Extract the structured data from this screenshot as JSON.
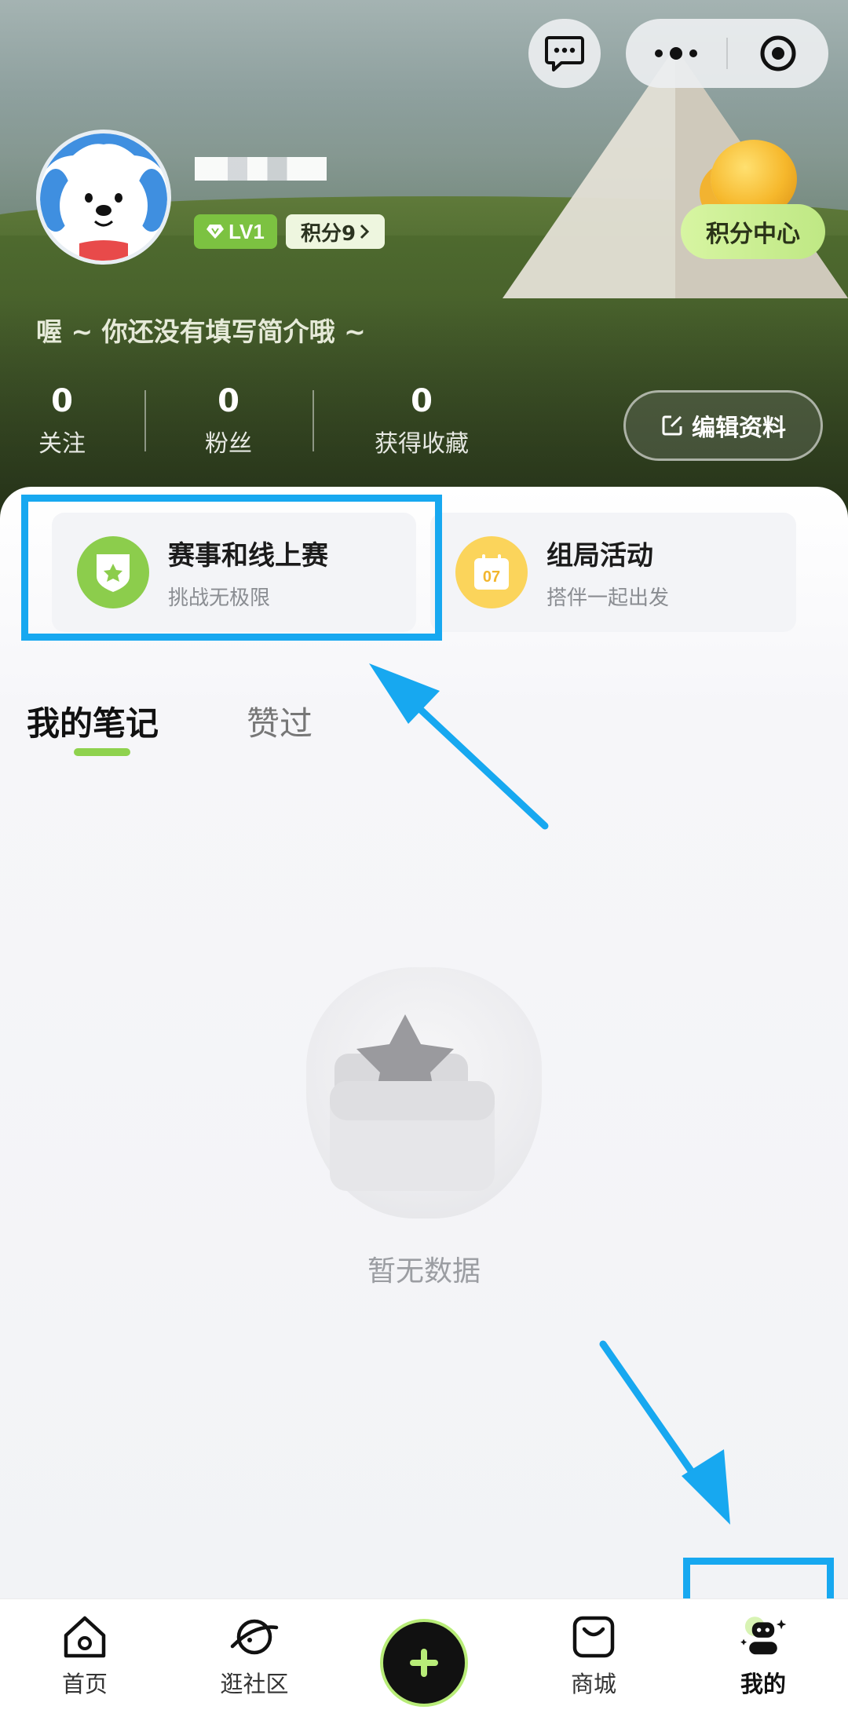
{
  "header": {
    "message_icon": "message-icon",
    "more_icon": "more-dots-icon",
    "target_icon": "target-icon"
  },
  "profile": {
    "level": "LV1",
    "points": "积分9",
    "points_center": "积分中心",
    "bio": "喔 ~ 你还没有填写简介哦 ~",
    "edit_label": "编辑资料",
    "stats": [
      {
        "value": "0",
        "label": "关注"
      },
      {
        "value": "0",
        "label": "粉丝"
      },
      {
        "value": "0",
        "label": "获得收藏"
      }
    ]
  },
  "cards": [
    {
      "title": "赛事和线上赛",
      "subtitle": "挑战无极限",
      "icon": "shield-star-icon",
      "icon_color": "#8ccd4c"
    },
    {
      "title": "组局活动",
      "subtitle": "搭伴一起出发",
      "icon": "calendar-icon",
      "icon_text": "07",
      "icon_color": "#fbd45b"
    }
  ],
  "tabs": {
    "active": "我的笔记",
    "other": "赞过"
  },
  "empty": {
    "text": "暂无数据"
  },
  "bottom_nav": {
    "items": [
      {
        "label": "首页",
        "icon": "home-icon"
      },
      {
        "label": "逛社区",
        "icon": "planet-icon"
      },
      {
        "label": "",
        "icon": "plus-icon"
      },
      {
        "label": "商城",
        "icon": "shop-bag-icon"
      },
      {
        "label": "我的",
        "icon": "profile-robot-icon"
      }
    ]
  },
  "colors": {
    "accent": "#8fd24e",
    "highlight": "#17a8f0"
  }
}
